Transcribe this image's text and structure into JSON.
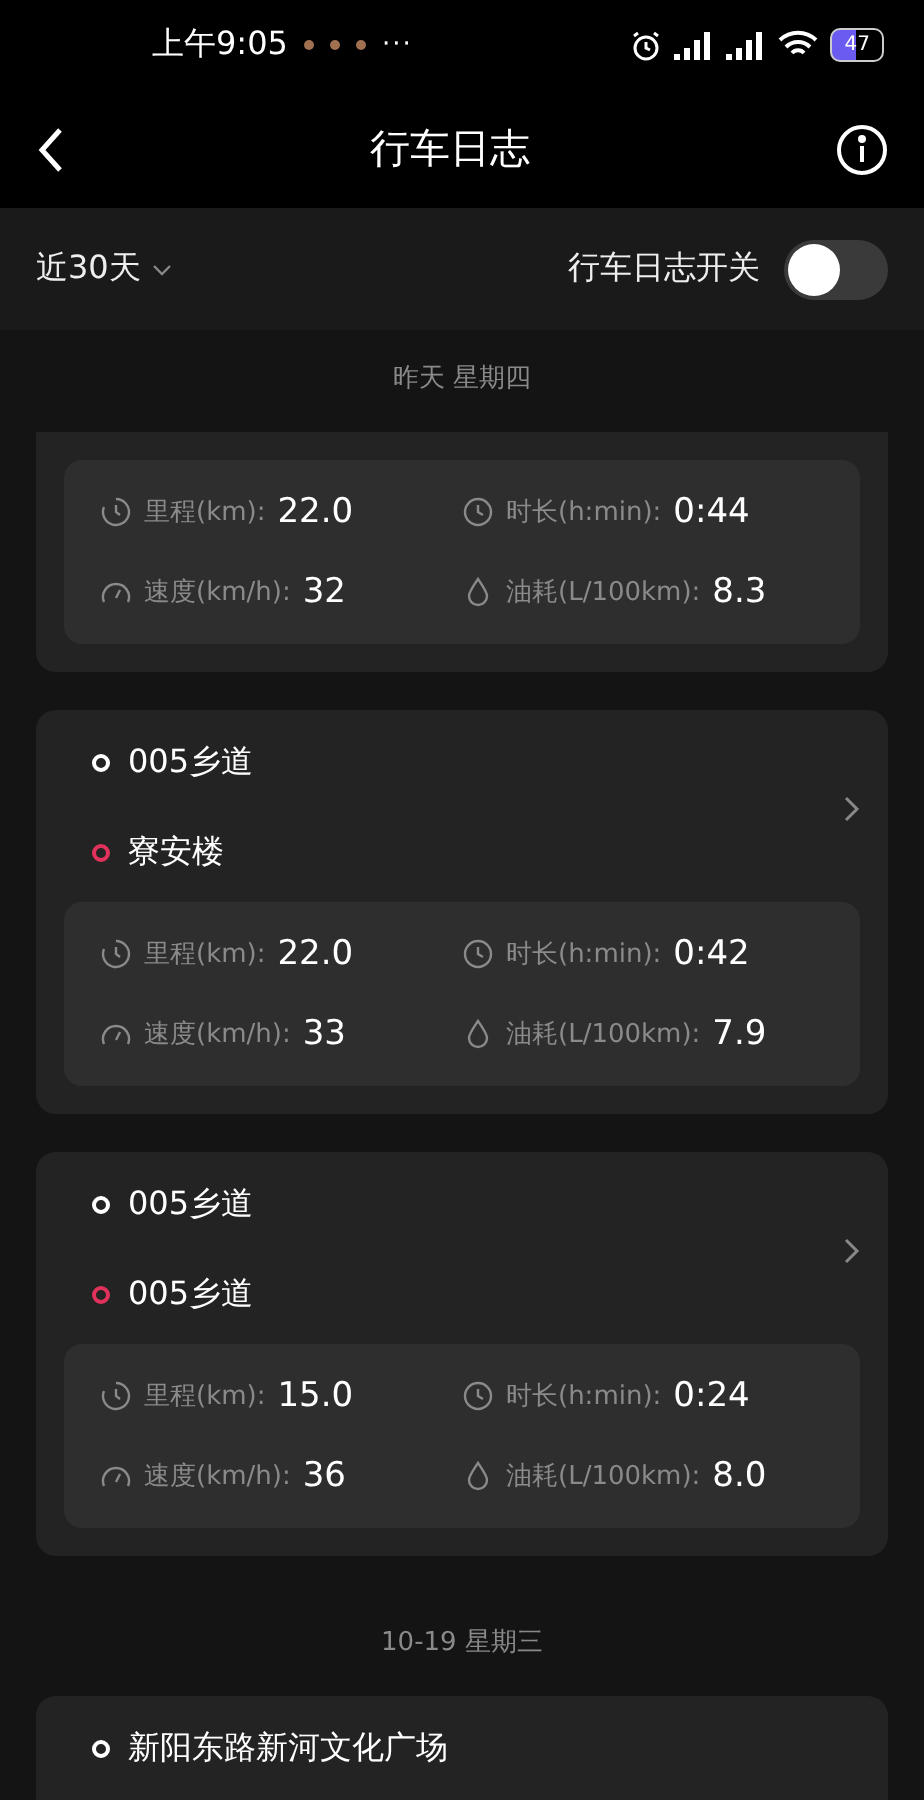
{
  "status_bar": {
    "time": "上午9:05",
    "more": "···",
    "battery": "47"
  },
  "nav": {
    "title": "行车日志"
  },
  "filter": {
    "range": "近30天",
    "switch_label": "行车日志开关",
    "on": false
  },
  "groups": [
    {
      "date": "昨天 星期四",
      "trips": [
        {
          "stats": [
            {
              "kind": "distance",
              "label": "里程(km):",
              "value": "22.0"
            },
            {
              "kind": "duration",
              "label": "时长(h:min):",
              "value": "0:44"
            },
            {
              "kind": "speed",
              "label": "速度(km/h):",
              "value": "32"
            },
            {
              "kind": "fuel",
              "label": "油耗(L/100km):",
              "value": "8.3"
            }
          ]
        },
        {
          "from": "005乡道",
          "to": "寮安楼",
          "stats": [
            {
              "kind": "distance",
              "label": "里程(km):",
              "value": "22.0"
            },
            {
              "kind": "duration",
              "label": "时长(h:min):",
              "value": "0:42"
            },
            {
              "kind": "speed",
              "label": "速度(km/h):",
              "value": "33"
            },
            {
              "kind": "fuel",
              "label": "油耗(L/100km):",
              "value": "7.9"
            }
          ]
        },
        {
          "from": "005乡道",
          "to": "005乡道",
          "stats": [
            {
              "kind": "distance",
              "label": "里程(km):",
              "value": "15.0"
            },
            {
              "kind": "duration",
              "label": "时长(h:min):",
              "value": "0:24"
            },
            {
              "kind": "speed",
              "label": "速度(km/h):",
              "value": "36"
            },
            {
              "kind": "fuel",
              "label": "油耗(L/100km):",
              "value": "8.0"
            }
          ]
        }
      ]
    },
    {
      "date": "10-19 星期三",
      "trips": [
        {
          "from": "新阳东路新河文化广场"
        }
      ]
    }
  ]
}
